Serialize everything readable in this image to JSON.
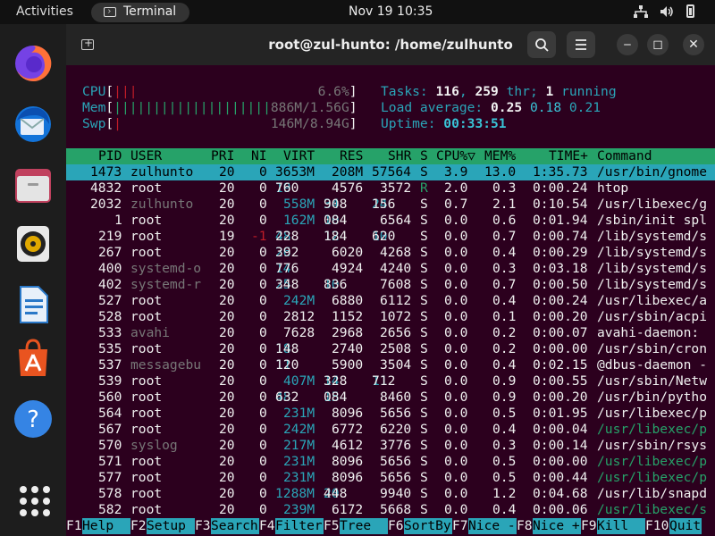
{
  "topbar": {
    "activities": "Activities",
    "app_name": "Terminal",
    "clock": "Nov 19  10:35",
    "icons": [
      "network-icon",
      "volume-icon",
      "battery-icon"
    ]
  },
  "dock": {
    "apps": [
      "Firefox",
      "Thunderbird",
      "Files",
      "Rhythmbox",
      "LibreOffice Writer",
      "Ubuntu Software",
      "Help",
      "Show Applications"
    ]
  },
  "window": {
    "title": "root@zul-hunto: /home/zulhunto",
    "buttons": {
      "minimize": "‒",
      "maximize": "◻",
      "close": "✕"
    }
  },
  "htop": {
    "meters": [
      {
        "label": "CPU",
        "bar": "|||",
        "value": "6.6%"
      },
      {
        "label": "Mem",
        "bar": "||||||||||||||||||||",
        "value": "886M/1.56G"
      },
      {
        "label": "Swp",
        "bar": "|",
        "value": "146M/8.94G"
      }
    ],
    "tasks": {
      "label": "Tasks:",
      "tasks": "116",
      "threads": "259",
      "thr_label": "thr;",
      "running": "1",
      "running_label": "running"
    },
    "load": {
      "label": "Load average:",
      "one": "0.25",
      "five": "0.18",
      "fifteen": "0.21"
    },
    "uptime": {
      "label": "Uptime:",
      "value": "00:33:51"
    },
    "columns": [
      "PID",
      "USER",
      "PRI",
      "NI",
      "VIRT",
      "RES",
      "SHR",
      "S",
      "CPU%",
      "MEM%",
      "TIME+",
      "Command"
    ],
    "sort_indicator": "▽",
    "processes": [
      [
        "1473",
        "zulhunto",
        "20",
        "0",
        "3653M",
        "208M",
        "57564",
        "S",
        "3.9",
        "13.0",
        "1:35.73",
        "/usr/bin/gnome"
      ],
      [
        "4832",
        "root",
        "20",
        "0",
        "19760",
        "4576",
        "3572",
        "R",
        "2.0",
        "0.3",
        "0:00.24",
        "htop"
      ],
      [
        "2032",
        "zulhunto",
        "20",
        "0",
        "558M",
        "34908",
        "24156",
        "S",
        "0.7",
        "2.1",
        "0:10.54",
        "/usr/libexec/g"
      ],
      [
        "1",
        "root",
        "20",
        "0",
        "162M",
        "10084",
        "6564",
        "S",
        "0.0",
        "0.6",
        "0:01.94",
        "/sbin/init spl"
      ],
      [
        "219",
        "root",
        "19",
        "-1",
        "48228",
        "12184",
        "10620",
        "S",
        "0.0",
        "0.7",
        "0:00.74",
        "/lib/systemd/s"
      ],
      [
        "267",
        "root",
        "20",
        "0",
        "26392",
        "6020",
        "4268",
        "S",
        "0.0",
        "0.4",
        "0:00.29",
        "/lib/systemd/s"
      ],
      [
        "400",
        "systemd-o",
        "20",
        "0",
        "14776",
        "4924",
        "4240",
        "S",
        "0.0",
        "0.3",
        "0:03.18",
        "/lib/systemd/s"
      ],
      [
        "402",
        "systemd-r",
        "20",
        "0",
        "25348",
        "10836",
        "7608",
        "S",
        "0.0",
        "0.7",
        "0:00.50",
        "/lib/systemd/s"
      ],
      [
        "527",
        "root",
        "20",
        "0",
        "242M",
        "6880",
        "6112",
        "S",
        "0.0",
        "0.4",
        "0:00.24",
        "/usr/libexec/a"
      ],
      [
        "528",
        "root",
        "20",
        "0",
        "2812",
        "1152",
        "1072",
        "S",
        "0.0",
        "0.1",
        "0:00.20",
        "/usr/sbin/acpi"
      ],
      [
        "533",
        "avahi",
        "20",
        "0",
        "7628",
        "2968",
        "2656",
        "S",
        "0.0",
        "0.2",
        "0:00.07",
        "avahi-daemon:"
      ],
      [
        "535",
        "root",
        "20",
        "0",
        "18148",
        "2740",
        "2508",
        "S",
        "0.0",
        "0.2",
        "0:00.00",
        "/usr/sbin/cron"
      ],
      [
        "537",
        "messagebu",
        "20",
        "0",
        "11120",
        "5900",
        "3504",
        "S",
        "0.0",
        "0.4",
        "0:02.15",
        "@dbus-daemon -"
      ],
      [
        "539",
        "root",
        "20",
        "0",
        "407M",
        "14328",
        "11712",
        "S",
        "0.0",
        "0.9",
        "0:00.55",
        "/usr/sbin/Netw"
      ],
      [
        "560",
        "root",
        "20",
        "0",
        "48632",
        "15084",
        "8460",
        "S",
        "0.0",
        "0.9",
        "0:00.20",
        "/usr/bin/pytho"
      ],
      [
        "564",
        "root",
        "20",
        "0",
        "231M",
        "8096",
        "5656",
        "S",
        "0.0",
        "0.5",
        "0:01.95",
        "/usr/libexec/p"
      ],
      [
        "567",
        "root",
        "20",
        "0",
        "242M",
        "6772",
        "6220",
        "S",
        "0.0",
        "0.4",
        "0:00.04",
        "/usr/libexec/p"
      ],
      [
        "570",
        "syslog",
        "20",
        "0",
        "217M",
        "4612",
        "3776",
        "S",
        "0.0",
        "0.3",
        "0:00.14",
        "/usr/sbin/rsys"
      ],
      [
        "571",
        "root",
        "20",
        "0",
        "231M",
        "8096",
        "5656",
        "S",
        "0.0",
        "0.5",
        "0:00.00",
        "/usr/libexec/p"
      ],
      [
        "577",
        "root",
        "20",
        "0",
        "231M",
        "8096",
        "5656",
        "S",
        "0.0",
        "0.5",
        "0:00.44",
        "/usr/libexec/p"
      ],
      [
        "578",
        "root",
        "20",
        "0",
        "1288M",
        "20448",
        "9940",
        "S",
        "0.0",
        "1.2",
        "0:04.68",
        "/usr/lib/snapd"
      ],
      [
        "582",
        "root",
        "20",
        "0",
        "239M",
        "6172",
        "5668",
        "S",
        "0.0",
        "0.4",
        "0:00.06",
        "/usr/libexec/s"
      ]
    ],
    "fkeys": [
      {
        "key": "F1",
        "label": "Help"
      },
      {
        "key": "F2",
        "label": "Setup"
      },
      {
        "key": "F3",
        "label": "Search"
      },
      {
        "key": "F4",
        "label": "Filter"
      },
      {
        "key": "F5",
        "label": "Tree"
      },
      {
        "key": "F6",
        "label": "SortBy"
      },
      {
        "key": "F7",
        "label": "Nice -"
      },
      {
        "key": "F8",
        "label": "Nice +"
      },
      {
        "key": "F9",
        "label": "Kill"
      },
      {
        "key": "F10",
        "label": "Quit"
      }
    ]
  }
}
